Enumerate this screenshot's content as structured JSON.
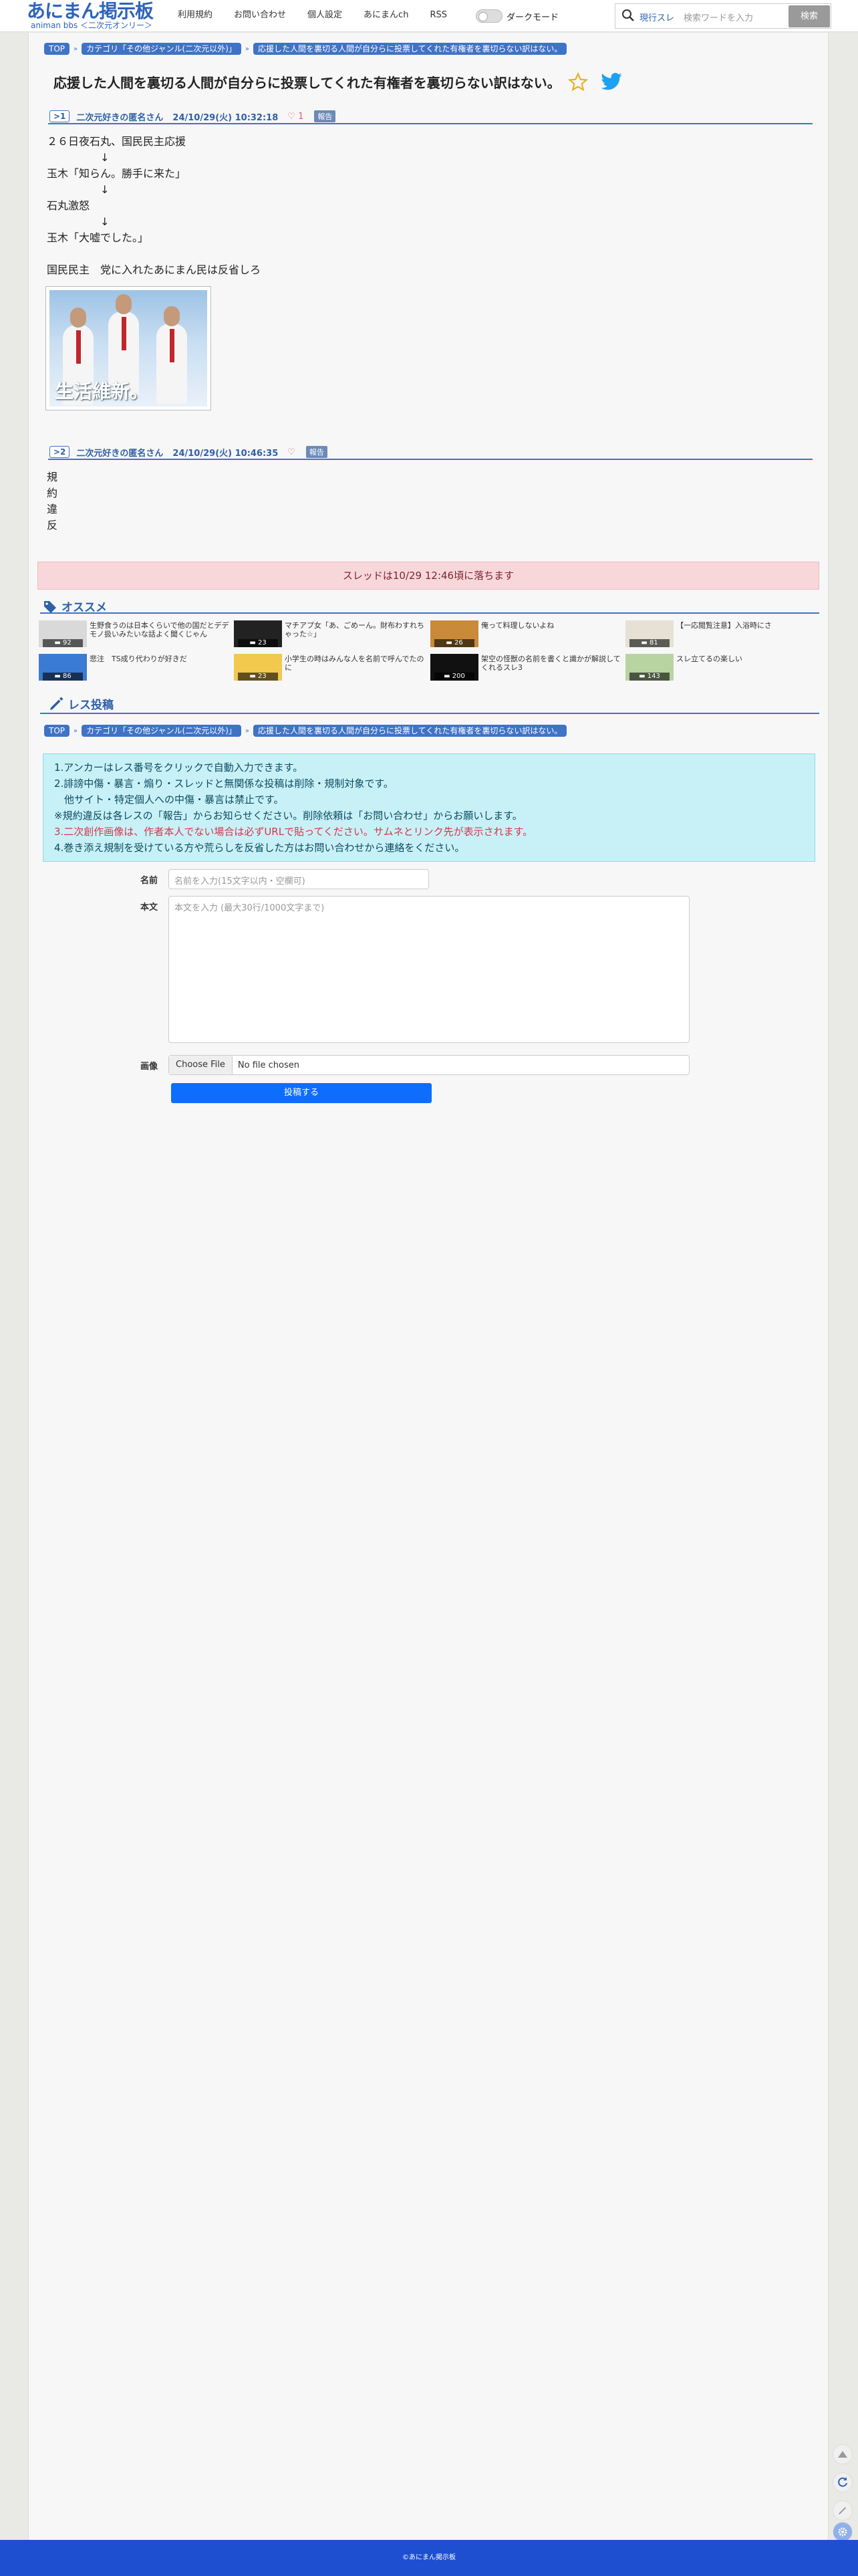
{
  "header": {
    "logo_main": "あにまん掲示板",
    "logo_sub": "animan bbs ＜二次元オンリー＞",
    "nav": [
      "利用規約",
      "お問い合わせ",
      "個人設定",
      "あにまんch",
      "RSS"
    ],
    "dark_mode_label": "ダークモード",
    "search_scope": "現行スレ",
    "search_placeholder": "検索ワードを入力",
    "search_button": "検索"
  },
  "breadcrumb": {
    "top": "TOP",
    "category": "カテゴリ「その他ジャンル(二次元以外)」",
    "thread": "応援した人間を裏切る人間が自分らに投票してくれた有権者を裏切らない訳はない。"
  },
  "thread_title": "応援した人間を裏切る人間が自分らに投票してくれた有権者を裏切らない訳はない。",
  "posts": [
    {
      "no": ">1",
      "name": "二次元好きの匿名さん",
      "date": "24/10/29(火) 10:32:18",
      "likes": "1",
      "report": "報告",
      "body": "２６日夜石丸、国民民主応援\n　　　　　↓\n玉木「知らん。勝手に来た」\n　　　　　↓\n石丸激怒\n　　　　　↓\n玉木「大嘘でした。」\n\n国民民主　党に入れたあにまん民は反省しろ",
      "image_caption": "生活維新。"
    },
    {
      "no": ">2",
      "name": "二次元好きの匿名さん",
      "date": "24/10/29(火) 10:46:35",
      "likes": "",
      "report": "報告",
      "body": "規\n約\n違\n反"
    }
  ],
  "expire_notice": "スレッドは10/29 12:46頃に落ちます",
  "recommend": {
    "heading": "オススメ",
    "items": [
      {
        "title": "生野食うのは日本くらいで他の国だとデデモノ扱いみたいな話よく聞くじゃん",
        "count": "92"
      },
      {
        "title": "マチアプ女「あ、ごめーん。財布わすれちゃった☆」",
        "count": "23"
      },
      {
        "title": "俺って料理しないよね",
        "count": "26"
      },
      {
        "title": "【一応閲覧注意】入浴時にさ",
        "count": "81"
      },
      {
        "title": "悲注　TS成り代わりが好きだ",
        "count": "86"
      },
      {
        "title": "小学生の時はみんな人を名前で呼んでたのに",
        "count": "23"
      },
      {
        "title": "架空の怪獣の名前を書くと識かが解説してくれるスレ3",
        "count": "200"
      },
      {
        "title": "スレ立てるの楽しい",
        "count": "143"
      }
    ]
  },
  "reply": {
    "heading": "レス投稿",
    "notice": [
      "1.アンカーはレス番号をクリックで自動入力できます。",
      "2.誹謗中傷・暴言・煽り・スレッドと無関係な投稿は削除・規制対象です。",
      "　他サイト・特定個人への中傷・暴言は禁止です。",
      "※規約違反は各レスの「報告」からお知らせください。削除依頼は「お問い合わせ」からお願いします。",
      "3.二次創作画像は、作者本人でない場合は必ずURLで貼ってください。サムネとリンク先が表示されます。",
      "4.巻き添え規制を受けている方や荒らしを反省した方はお問い合わせから連絡をください。"
    ],
    "name_label": "名前",
    "name_placeholder": "名前を入力(15文字以内・空欄可)",
    "body_label": "本文",
    "body_placeholder": "本文を入力 (最大30行/1000文字まで)",
    "image_label": "画像",
    "file_button": "Choose File",
    "file_status": "No file chosen",
    "submit": "投稿する"
  },
  "footer": "©あにまん掲示板",
  "colors": {
    "accent": "#3f73c6",
    "footer": "#1f4fd1",
    "notice_bg": "#c8f1f7",
    "banner_bg": "#f8d7da",
    "submit": "#0d6efd"
  }
}
